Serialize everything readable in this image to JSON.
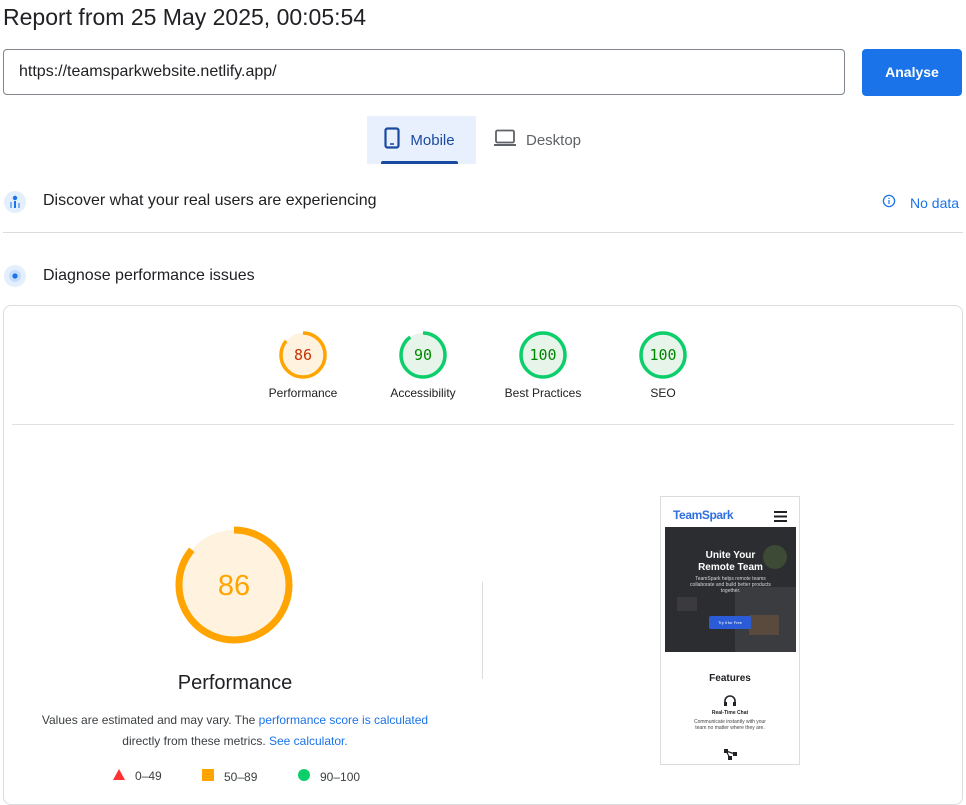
{
  "header": {
    "title": "Report from 25 May 2025, 00:05:54"
  },
  "search": {
    "url": "https://teamsparkwebsite.netlify.app/",
    "analyse_label": "Analyse"
  },
  "tabs": {
    "mobile": "Mobile",
    "desktop": "Desktop"
  },
  "sections": {
    "real_users": {
      "title": "Discover what your real users are experiencing",
      "no_data": "No data"
    },
    "diagnose": {
      "title": "Diagnose performance issues"
    }
  },
  "scores": [
    {
      "label": "Performance",
      "value": "86",
      "fraction": 0.86,
      "color": "#ffa400",
      "bg": "#fff3e0",
      "text": "#c33300"
    },
    {
      "label": "Accessibility",
      "value": "90",
      "fraction": 0.9,
      "color": "#0cce6b",
      "bg": "#e6f4ea",
      "text": "#008800"
    },
    {
      "label": "Best Practices",
      "value": "100",
      "fraction": 1.0,
      "color": "#0cce6b",
      "bg": "#e6f4ea",
      "text": "#008800"
    },
    {
      "label": "SEO",
      "value": "100",
      "fraction": 1.0,
      "color": "#0cce6b",
      "bg": "#e6f4ea",
      "text": "#008800"
    }
  ],
  "performance": {
    "score": "86",
    "fraction": 0.86,
    "title": "Performance",
    "desc_prefix": "Values are estimated and may vary. The ",
    "desc_link1": "performance score is calculated",
    "desc_middle": "directly from these metrics. ",
    "desc_link2": "See calculator.",
    "legend": {
      "poor": "0–49",
      "average": "50–89",
      "good": "90–100"
    }
  },
  "screenshot": {
    "brand": "TeamSpark",
    "hero_title_1": "Unite Your",
    "hero_title_2": "Remote Team",
    "hero_sub": "TeamSpark helps remote teams collaborate and build better products together.",
    "hero_btn": "Try it for Free",
    "features": "Features",
    "feature_1": "Real-Time Chat",
    "feature_1_desc": "Communicate instantly with your team no matter where they are."
  },
  "colors": {
    "accent": "#1a73e8",
    "orange": "#ffa400",
    "green": "#0cce6b",
    "red": "#ff3333"
  }
}
